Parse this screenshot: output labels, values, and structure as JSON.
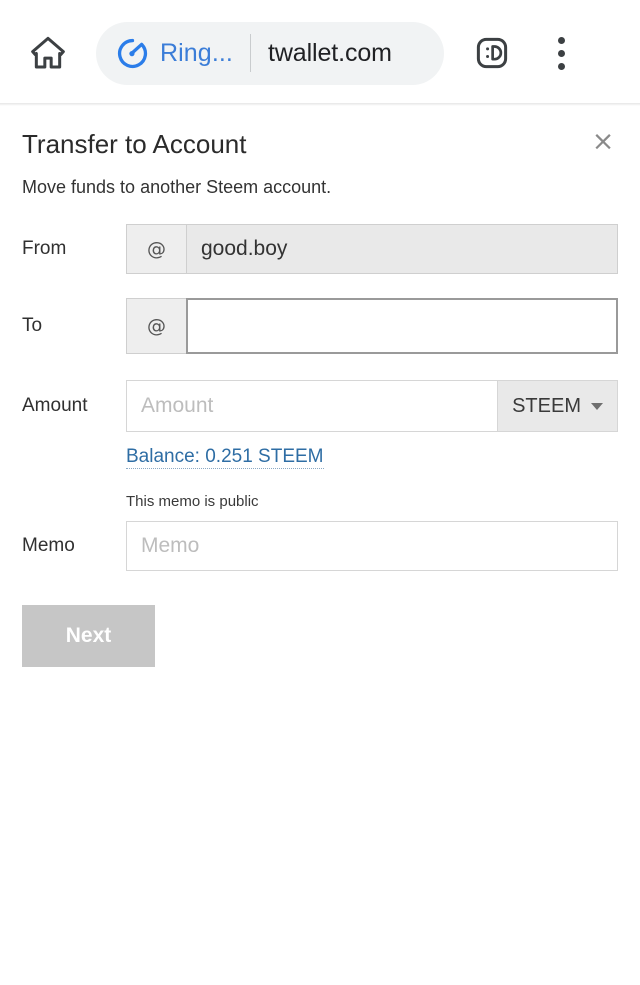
{
  "browser": {
    "home_icon": "home-icon",
    "omnibox": {
      "app_icon": "gauge-icon",
      "app_name": "Ring...",
      "url": "twallet.com"
    },
    "emoji_button_label": ":D",
    "menu_icon": "three-dot-menu-icon"
  },
  "dialog": {
    "title": "Transfer to Account",
    "subtitle": "Move funds to another Steem account.",
    "close_label": "×"
  },
  "form": {
    "from": {
      "label": "From",
      "prefix": "@",
      "value": "good.boy",
      "placeholder": ""
    },
    "to": {
      "label": "To",
      "prefix": "@",
      "value": "",
      "placeholder": ""
    },
    "amount": {
      "label": "Amount",
      "value": "",
      "placeholder": "Amount",
      "unit": "STEEM",
      "balance_link": "Balance: 0.251 STEEM"
    },
    "memo": {
      "label": "Memo",
      "hint": "This memo is public",
      "value": "",
      "placeholder": "Memo"
    }
  },
  "actions": {
    "next_label": "Next"
  },
  "colors": {
    "link": "#2e6da4",
    "app_name": "#3b7dd8",
    "disabled_button": "#c6c6c6"
  }
}
